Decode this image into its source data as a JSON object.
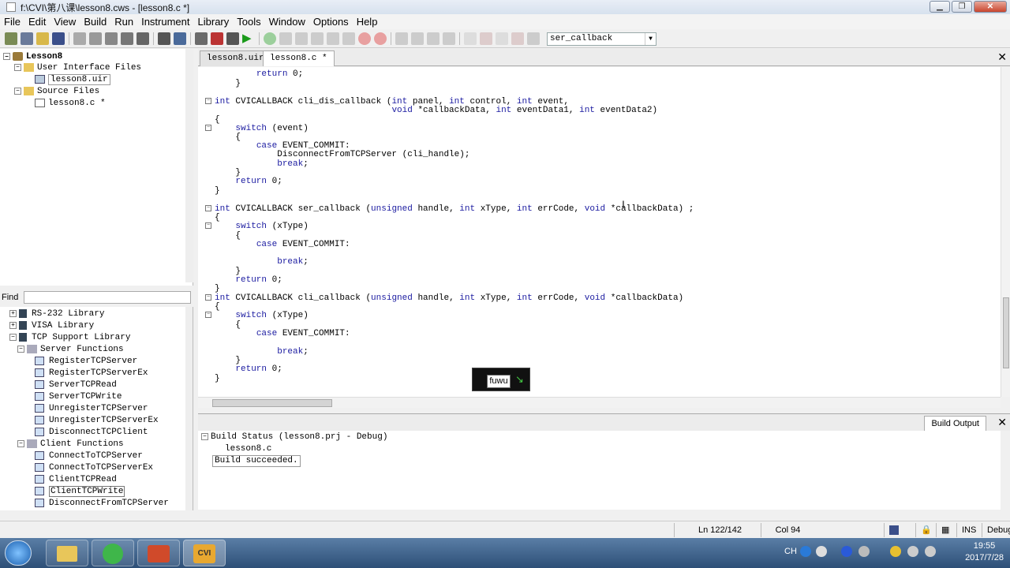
{
  "window": {
    "title": "f:\\CVI\\第八课\\lesson8.cws - [lesson8.c *]"
  },
  "menu": [
    "File",
    "Edit",
    "View",
    "Build",
    "Run",
    "Instrument",
    "Library",
    "Tools",
    "Window",
    "Options",
    "Help"
  ],
  "toolbar": {
    "function_select": "ser_callback"
  },
  "project_tree": {
    "root": "Lesson8",
    "folders": [
      {
        "label": "User Interface Files",
        "files": [
          "lesson8.uir"
        ]
      },
      {
        "label": "Source Files",
        "files": [
          "lesson8.c *"
        ]
      }
    ]
  },
  "find": {
    "label": "Find",
    "value": ""
  },
  "library_tree": {
    "libraries": [
      "RS-232 Library",
      "VISA Library",
      "TCP Support Library"
    ],
    "server_group": "Server Functions",
    "server_functions": [
      "RegisterTCPServer",
      "RegisterTCPServerEx",
      "ServerTCPRead",
      "ServerTCPWrite",
      "UnregisterTCPServer",
      "UnregisterTCPServerEx",
      "DisconnectTCPClient"
    ],
    "client_group": "Client Functions",
    "client_functions": [
      "ConnectToTCPServer",
      "ConnectToTCPServerEx",
      "ClientTCPRead",
      "ClientTCPWrite",
      "DisconnectFromTCPServer"
    ]
  },
  "tabs": [
    "lesson8.uir",
    "lesson8.c *"
  ],
  "code_lines": [
    "        return 0;",
    "    }",
    "",
    "int CVICALLBACK cli_dis_callback (int panel, int control, int event,",
    "                                  void *callbackData, int eventData1, int eventData2)",
    "{",
    "    switch (event)",
    "    {",
    "        case EVENT_COMMIT:",
    "            DisconnectFromTCPServer (cli_handle);",
    "            break;",
    "    }",
    "    return 0;",
    "}",
    "",
    "int CVICALLBACK ser_callback (unsigned handle, int xType, int errCode, void *callbackData) ;",
    "{",
    "    switch (xType)",
    "    {",
    "        case EVENT_COMMIT:",
    "",
    "            break;",
    "    }",
    "    return 0;",
    "}",
    "int CVICALLBACK cli_callback (unsigned handle, int xType, int errCode, void *callbackData)",
    "{",
    "    switch (xType)",
    "    {",
    "        case EVENT_COMMIT:",
    "",
    "            break;",
    "    }",
    "    return 0;",
    "}"
  ],
  "ime_popup": {
    "text": "fuwu"
  },
  "build": {
    "tab_label": "Build Output",
    "status": "Build Status (lesson8.prj - Debug)",
    "file": "lesson8.c",
    "result": "Build succeeded."
  },
  "statusbar": {
    "line": "Ln 122/142",
    "col": "Col 94",
    "ins": "INS",
    "mode": "Debug"
  },
  "clock": {
    "time": "19:55",
    "date": "2017/7/28"
  },
  "tray": {
    "ime": "CH"
  }
}
